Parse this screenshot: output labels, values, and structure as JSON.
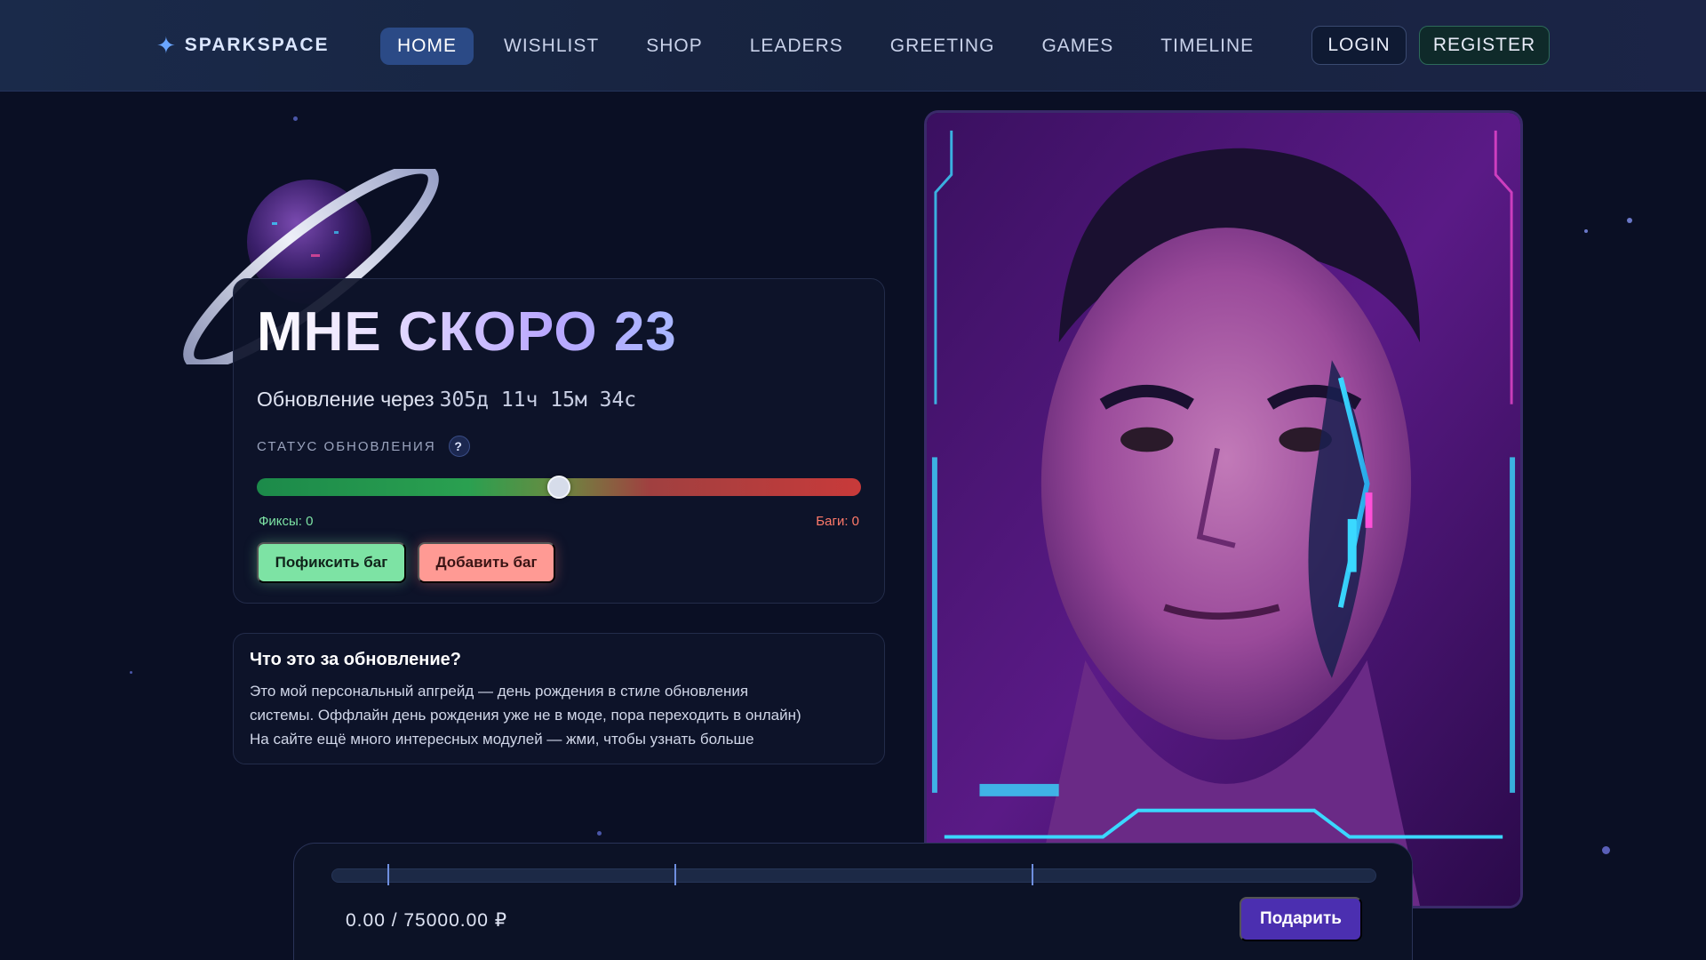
{
  "brand": {
    "name": "SPARKSPACE",
    "icon": "sparkle-icon"
  },
  "nav": {
    "items": [
      {
        "label": "HOME",
        "active": true
      },
      {
        "label": "WISHLIST",
        "active": false
      },
      {
        "label": "SHOP",
        "active": false
      },
      {
        "label": "LEADERS",
        "active": false
      },
      {
        "label": "GREETING",
        "active": false
      },
      {
        "label": "GAMES",
        "active": false
      },
      {
        "label": "TIMELINE",
        "active": false
      }
    ]
  },
  "auth": {
    "login_label": "LOGIN",
    "register_label": "REGISTER"
  },
  "hero": {
    "title": "МНЕ СКОРО 23",
    "countdown_prefix": "Обновление через",
    "countdown_value": "305д 11ч 15м 34с",
    "status_label": "СТАТУС ОБНОВЛЕНИЯ",
    "help_icon": "?",
    "progress_fraction": 0.5,
    "fixes_label": "Фиксы: 0",
    "bugs_label": "Баги: 0",
    "fix_button": "Пофиксить баг",
    "add_button": "Добавить баг"
  },
  "info": {
    "title": "Что это за обновление?",
    "line1": "Это мой персональный апгрейд — день рождения в стиле обновления",
    "line2": "системы. Оффлайн день рождения уже не в моде, пора переходить в онлайн)",
    "line3": "На сайте ещё много интересных модулей — жми, чтобы узнать больше"
  },
  "gift": {
    "amount_text": "0.00 / 75000.00 ₽",
    "button_label": "Подарить",
    "progress_fraction": 0.0
  },
  "colors": {
    "background": "#0a0f24",
    "accent_active_nav": "#2b4a86",
    "fix_green": "#7de3a4",
    "bug_red": "#ff9a94",
    "gift_purple": "#4b2fb0"
  }
}
